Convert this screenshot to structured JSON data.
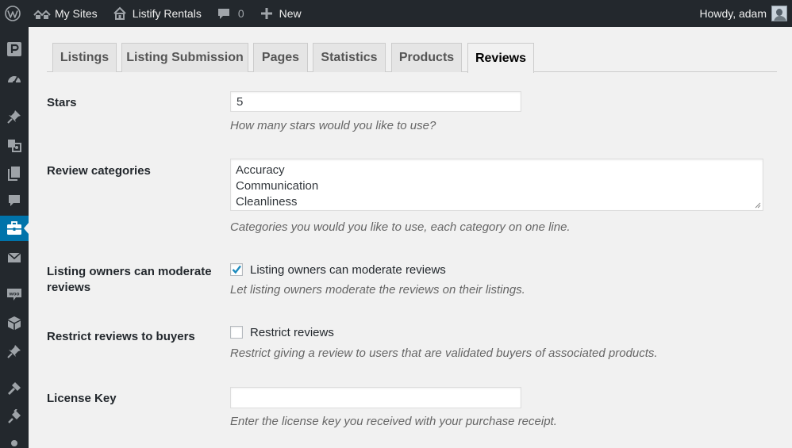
{
  "adminbar": {
    "my_sites": "My Sites",
    "site_name": "Listify Rentals",
    "comments_count": "0",
    "new_label": "New",
    "howdy": "Howdy, adam"
  },
  "sidebar": {
    "items": [
      "parking-icon",
      "dashboard-icon",
      "pin-icon",
      "media-icon",
      "pages-icon",
      "comments-icon",
      "job-listings-icon",
      "mail-icon",
      "woocommerce-icon",
      "products-icon",
      "pin-icon",
      "appearance-icon",
      "plugins-icon",
      "users-icon"
    ],
    "active": "job-listings-icon",
    "active_color": "#0073aa"
  },
  "tabs": [
    "Listings",
    "Listing Submission",
    "Pages",
    "Statistics",
    "Products",
    "Reviews"
  ],
  "active_tab": "Reviews",
  "form": {
    "stars": {
      "label": "Stars",
      "value": "5",
      "description": "How many stars would you like to use?"
    },
    "categories": {
      "label": "Review categories",
      "lines": [
        "Accuracy",
        "Communication",
        "Cleanliness"
      ],
      "description": "Categories you would you like to use, each category on one line."
    },
    "moderate": {
      "label": "Listing owners can moderate reviews",
      "checkbox_label": "Listing owners can moderate reviews",
      "checked": true,
      "description": "Let listing owners moderate the reviews on their listings."
    },
    "restrict": {
      "label": "Restrict reviews to buyers",
      "checkbox_label": "Restrict reviews",
      "checked": false,
      "description": "Restrict giving a review to users that are validated buyers of associated products."
    },
    "license": {
      "label": "License Key",
      "value": "",
      "description": "Enter the license key you received with your purchase receipt."
    }
  }
}
